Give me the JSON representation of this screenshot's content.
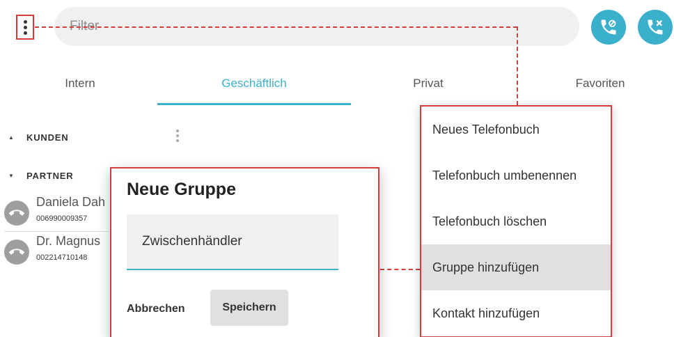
{
  "toolbar": {
    "menu_icon": "more-vert-icon",
    "filter_placeholder": "Filter",
    "call_blocked_icon": "phone-blocked-icon",
    "call_missed_icon": "phone-missed-icon",
    "accent_color": "#3ab0cc",
    "highlight_color": "#d93a3a"
  },
  "tabs": [
    {
      "label": "Intern"
    },
    {
      "label": "Geschäftlich",
      "active": true
    },
    {
      "label": "Privat"
    },
    {
      "label": "Favoriten"
    }
  ],
  "groups": [
    {
      "label": "KUNDEN",
      "state": "collapsed"
    },
    {
      "label": "PARTNER",
      "state": "expanded"
    }
  ],
  "contacts": [
    {
      "name": "Daniela Dah",
      "number": "006990009357"
    },
    {
      "name": "Dr. Magnus",
      "number": "002214710148"
    }
  ],
  "dialog": {
    "title": "Neue Gruppe",
    "field_value": "Zwischenhändler",
    "cancel_label": "Abbrechen",
    "save_label": "Speichern"
  },
  "menu": {
    "items": [
      {
        "label": "Neues Telefonbuch"
      },
      {
        "label": "Telefonbuch umbenennen"
      },
      {
        "label": "Telefonbuch löschen"
      },
      {
        "label": "Gruppe hinzufügen",
        "highlighted": true
      },
      {
        "label": "Kontakt hinzufügen"
      }
    ]
  }
}
